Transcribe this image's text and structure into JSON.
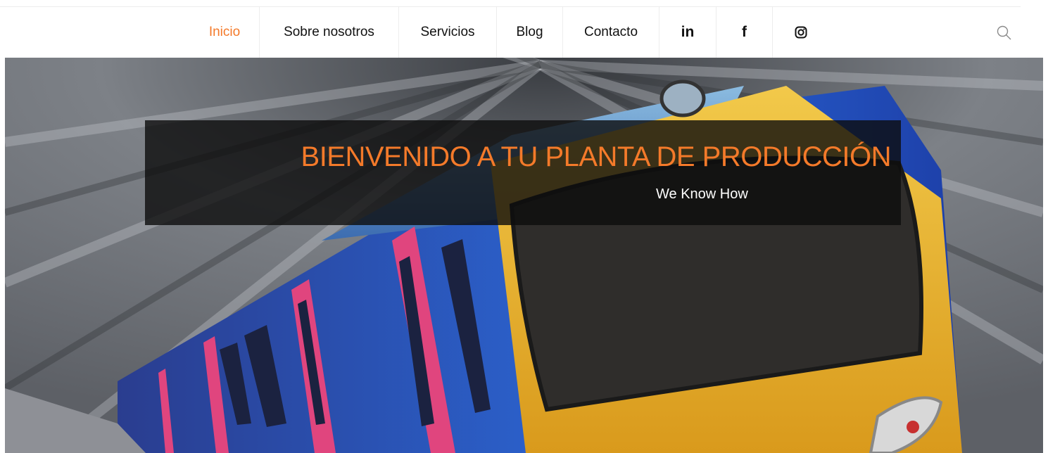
{
  "nav": {
    "items": [
      {
        "label": "Inicio",
        "active": true
      },
      {
        "label": "Sobre nosotros"
      },
      {
        "label": "Servicios"
      },
      {
        "label": "Blog"
      },
      {
        "label": "Contacto"
      }
    ],
    "social": [
      {
        "label": "in",
        "icon": "linkedin-icon"
      },
      {
        "label": "f",
        "icon": "facebook-icon"
      },
      {
        "icon": "instagram-icon"
      }
    ],
    "search_icon": "search-icon"
  },
  "hero": {
    "title": "BIENVENIDO A TU PLANTA DE PRODUCCIÓN",
    "subtitle": "We Know How",
    "image": "high-speed-train-photo"
  },
  "colors": {
    "accent": "#f47a2a",
    "text": "#111111",
    "banner_overlay": "rgba(12,12,12,0.80)",
    "train_blue": "#1f4fb8",
    "train_pink": "#e0457e",
    "train_yellow": "#e8b62a"
  }
}
